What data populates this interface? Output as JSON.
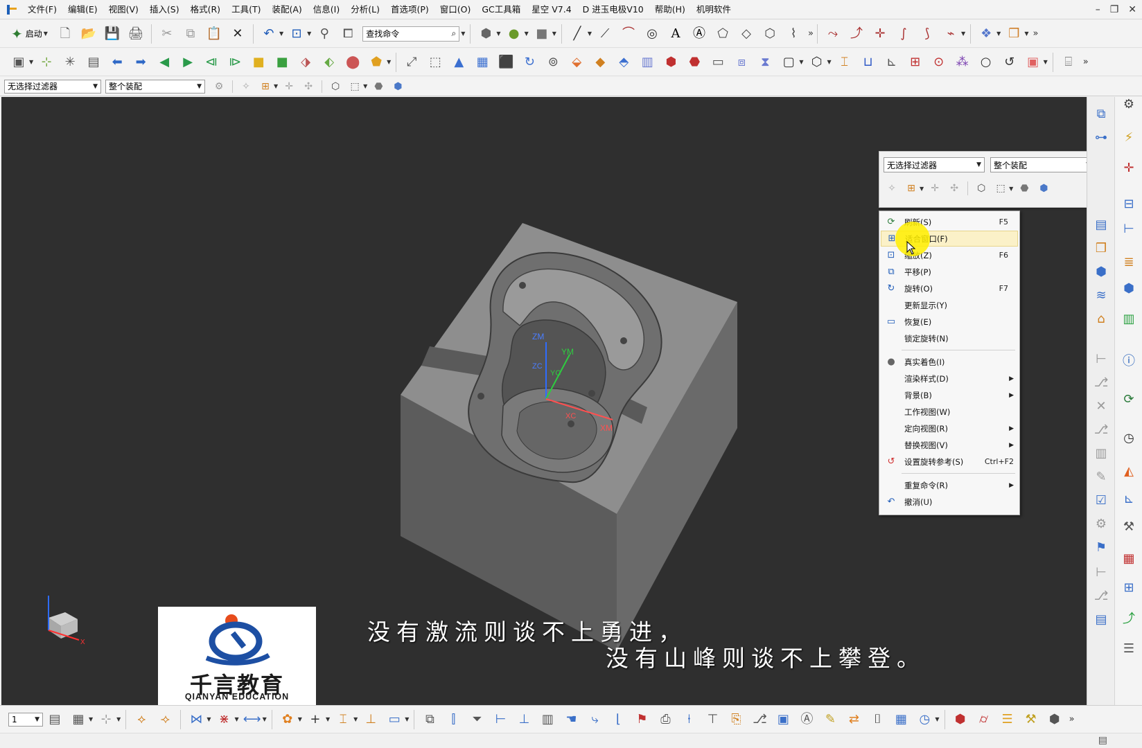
{
  "menubar": {
    "items": [
      "文件(F)",
      "编辑(E)",
      "视图(V)",
      "插入(S)",
      "格式(R)",
      "工具(T)",
      "装配(A)",
      "信息(I)",
      "分析(L)",
      "首选项(P)",
      "窗口(O)",
      "GC工具箱",
      "星空 V7.4",
      "D 进玉电极V10",
      "帮助(H)",
      "机明软件"
    ],
    "win_min": "–",
    "win_restore": "❐",
    "win_close": "✕"
  },
  "toolbar1": {
    "start_label": "启动",
    "search_placeholder": "查找命令"
  },
  "toolbar3": {
    "filter_combo": "无选择过滤器",
    "scope_combo": "整个装配"
  },
  "popup_bar": {
    "filter_combo": "无选择过滤器",
    "scope_combo": "整个装配"
  },
  "context_menu": {
    "items": [
      {
        "label": "刷新(S)",
        "shortcut": "F5",
        "icon": "refresh-icon"
      },
      {
        "label": "适合窗口(F)",
        "shortcut": "",
        "icon": "fit-window-icon"
      },
      {
        "label": "缩放(Z)",
        "shortcut": "F6",
        "icon": "zoom-icon"
      },
      {
        "label": "平移(P)",
        "shortcut": "",
        "icon": "pan-icon"
      },
      {
        "label": "旋转(O)",
        "shortcut": "F7",
        "icon": "rotate-icon"
      },
      {
        "label": "更新显示(Y)",
        "shortcut": "",
        "icon": ""
      },
      {
        "label": "恢复(E)",
        "shortcut": "",
        "icon": "restore-icon"
      },
      {
        "label": "锁定旋转(N)",
        "shortcut": "",
        "icon": ""
      },
      {
        "label": "真实着色(I)",
        "shortcut": "",
        "icon": "true-shading-icon"
      },
      {
        "label": "渲染样式(D)",
        "shortcut": "",
        "icon": ""
      },
      {
        "label": "背景(B)",
        "shortcut": "",
        "icon": ""
      },
      {
        "label": "工作视图(W)",
        "shortcut": "",
        "icon": ""
      },
      {
        "label": "定向视图(R)",
        "shortcut": "",
        "icon": ""
      },
      {
        "label": "替换视图(V)",
        "shortcut": "",
        "icon": ""
      },
      {
        "label": "设置旋转参考(S)",
        "shortcut": "Ctrl+F2",
        "icon": "rotate-reference-icon"
      },
      {
        "label": "重复命令(R)",
        "shortcut": "",
        "icon": ""
      },
      {
        "label": "撤消(U)",
        "shortcut": "",
        "icon": "undo-icon"
      }
    ]
  },
  "viewport": {
    "axis_labels": {
      "zm": "ZM",
      "ym": "YM",
      "xm": "XM",
      "zc": "ZC",
      "yc": "YC",
      "xc": "XC"
    },
    "triad_x": "X"
  },
  "logo": {
    "name": "千言教育",
    "english": "QIANYAN EDUCATION"
  },
  "subtitles": {
    "line1": "没有激流则谈不上勇进，",
    "line2": "没有山峰则谈不上攀登。"
  },
  "bottombar": {
    "layer_combo": "1"
  },
  "colors": {
    "viewport_bg": "#2f2f2f",
    "highlight": "#fbf1c8",
    "cursor_glow": "#ffee00"
  }
}
